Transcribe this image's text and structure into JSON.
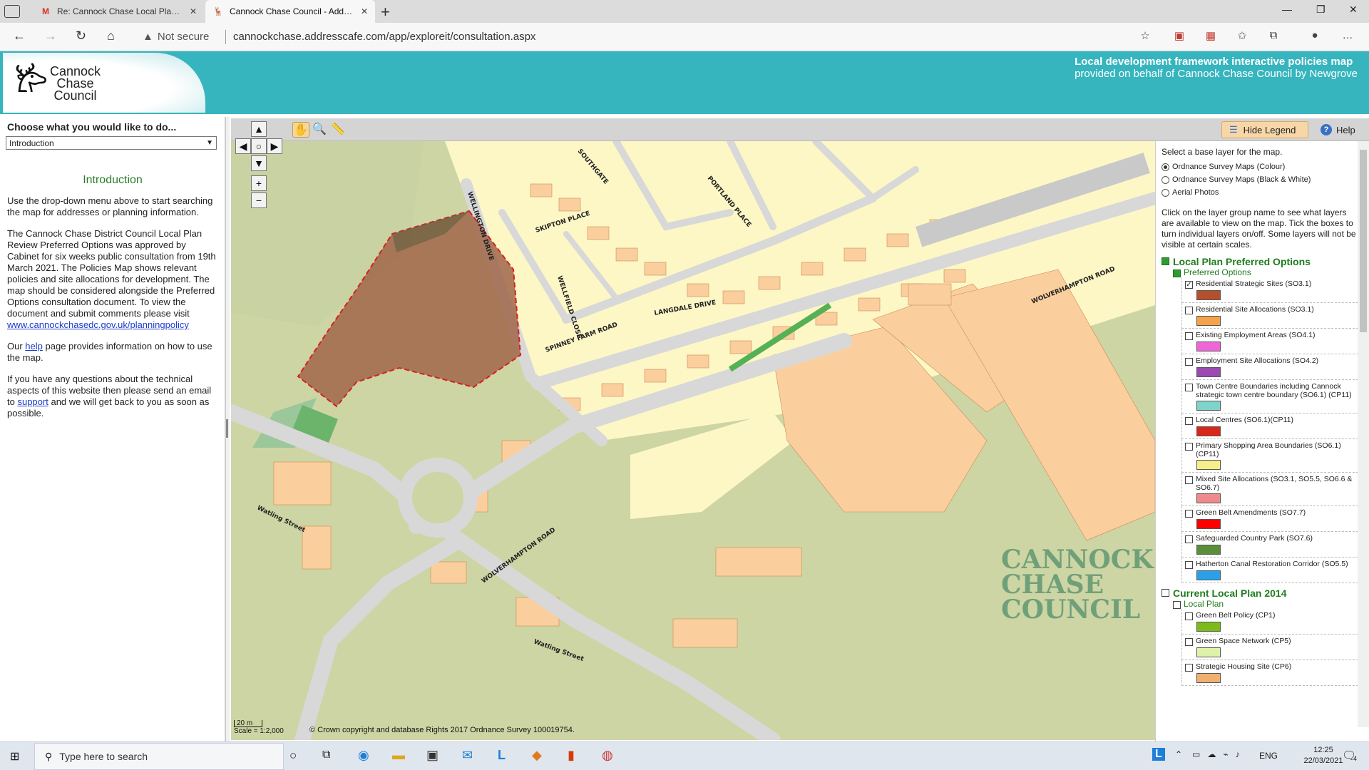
{
  "browser": {
    "tabs": [
      {
        "title": "Re: Cannock Chase Local Plan - F",
        "icon": "gmail-icon",
        "active": false
      },
      {
        "title": "Cannock Chase Council - Addres",
        "icon": "stag-icon",
        "active": true
      }
    ],
    "url_warning": "Not secure",
    "url": "cannockchase.addresscafe.com/app/exploreit/consultation.aspx"
  },
  "header": {
    "logo_text": "Cannock\nChase\nCouncil",
    "tagline_1": "Local development framework interactive policies map",
    "tagline_2": "provided on behalf of Cannock Chase Council by Newgrove",
    "color": "#36b5be"
  },
  "left_panel": {
    "choose_label": "Choose what you would like to do...",
    "select_value": "Introduction",
    "title": "Introduction",
    "para1": "Use the drop-down menu above to start searching the map for addresses or planning information.",
    "para2": "The Cannock Chase District Council Local Plan Review Preferred Options was approved by Cabinet for six weeks public consultation from 19th March 2021. The Policies Map shows relevant policies and site allocations for development. The map should be considered alongside the Preferred Options consultation document. To view the document and submit comments please visit",
    "para2_link": "www.cannockchasedc.gov.uk/planningpolicy",
    "para3_pre": "Our",
    "para3_link": "help",
    "para3_post": "page provides information on how to use the map.",
    "para4_pre": "If you have any questions about the technical aspects of this website then please send an email to",
    "para4_link": "support",
    "para4_post": "and we will get back to you as soon as possible."
  },
  "toolbar": {
    "hide_legend": "Hide Legend",
    "help": "Help"
  },
  "map": {
    "roads": [
      "SOUTHGATE",
      "PORTLAND PLACE",
      "WELLINGTON DRIVE",
      "SKIPTON PLACE",
      "WELLFIELD CLOSE",
      "LANGDALE DRIVE",
      "SPINNEY FARM ROAD",
      "WOLVERHAMPTON ROAD",
      "WOLVERHAMPTON ROAD",
      "Watling Street",
      "Watling Street"
    ],
    "watermark": "CANNOCK\nCHASE\nCOUNCIL",
    "scale_bar": "20 m",
    "scale_text": "Scale = 1:2,000",
    "copyright": "© Crown copyright and database Rights 2017 Ordnance Survey 100019754."
  },
  "legend": {
    "base_prompt": "Select a base layer for the map.",
    "base_layers": [
      {
        "label": "Ordnance Survey Maps (Colour)",
        "selected": true
      },
      {
        "label": "Ordnance Survey Maps (Black & White)",
        "selected": false
      },
      {
        "label": "Aerial Photos",
        "selected": false
      }
    ],
    "instructions": "Click on the layer group name to see what layers are available to view on the map. Tick the boxes to turn individual layers on/off. Some layers will not be visible at certain scales.",
    "group1": "Local Plan Preferred Options",
    "group1_sub": "Preferred Options",
    "layers": [
      {
        "label": "Residential Strategic Sites (SO3.1)",
        "checked": true,
        "swatch": "#b5502c"
      },
      {
        "label": "Residential Site Allocations (SO3.1)",
        "checked": false,
        "swatch": "#f5a24a"
      },
      {
        "label": "Existing Employment Areas (SO4.1)",
        "checked": false,
        "swatch": "#ef64d6"
      },
      {
        "label": "Employment Site Allocations (SO4.2)",
        "checked": false,
        "swatch": "#9b4ab0"
      },
      {
        "label": "Town Centre Boundaries including Cannock strategic town centre boundary (SO6.1) (CP11)",
        "checked": false,
        "swatch": "#7fd4c9"
      },
      {
        "label": "Local Centres (SO6.1)(CP11)",
        "checked": false,
        "swatch": "#d8261a"
      },
      {
        "label": "Primary Shopping Area Boundaries (SO6.1) (CP11)",
        "checked": false,
        "swatch": "#f6ee8a"
      },
      {
        "label": "Mixed Site Allocations (SO3.1, SO5.5, SO6.6 & SO6.7)",
        "checked": false,
        "swatch": "#f08a8a"
      },
      {
        "label": "Green Belt Amendments (SO7.7)",
        "checked": false,
        "swatch": "#ff0000"
      },
      {
        "label": "Safeguarded Country Park (SO7.6)",
        "checked": false,
        "swatch": "#5a8f3a"
      },
      {
        "label": "Hatherton Canal Restoration Corridor (SO5.5)",
        "checked": false,
        "swatch": "#2aa0e8"
      }
    ],
    "group2": "Current Local Plan 2014",
    "group2_sub": "Local Plan",
    "layers2": [
      {
        "label": "Green Belt Policy (CP1)",
        "checked": false,
        "swatch": "#7dbb1a"
      },
      {
        "label": "Green Space Network (CP5)",
        "checked": false,
        "swatch": "#dff3a8"
      },
      {
        "label": "Strategic Housing Site (CP6)",
        "checked": false,
        "swatch": "#f0b070"
      }
    ]
  },
  "taskbar": {
    "search_placeholder": "Type here to search",
    "language": "ENG",
    "time": "12:25",
    "date": "22/03/2021",
    "notifications": "4"
  }
}
